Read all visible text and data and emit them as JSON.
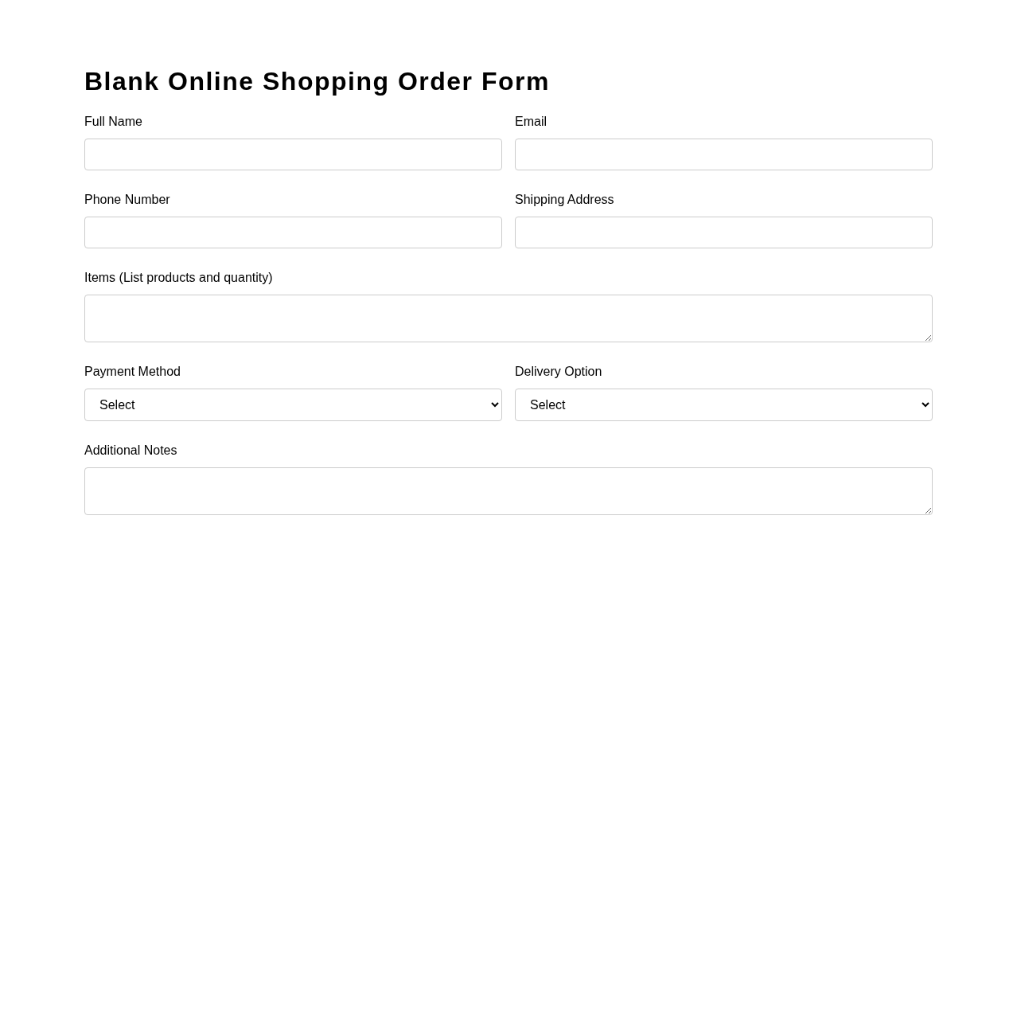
{
  "title": "Blank Online Shopping Order Form",
  "fields": [
    {
      "label": "Full Name",
      "kind": "text"
    },
    {
      "label": "Email",
      "kind": "text"
    },
    {
      "label": "Phone Number",
      "kind": "text"
    },
    {
      "label": "Shipping Address",
      "kind": "text"
    },
    {
      "label": "Items (List products and quantity)",
      "kind": "textarea"
    },
    {
      "label": "Payment Method",
      "kind": "select",
      "value": "Select"
    },
    {
      "label": "Delivery Option",
      "kind": "select",
      "value": "Select"
    },
    {
      "label": "Additional Notes",
      "kind": "textarea"
    }
  ]
}
